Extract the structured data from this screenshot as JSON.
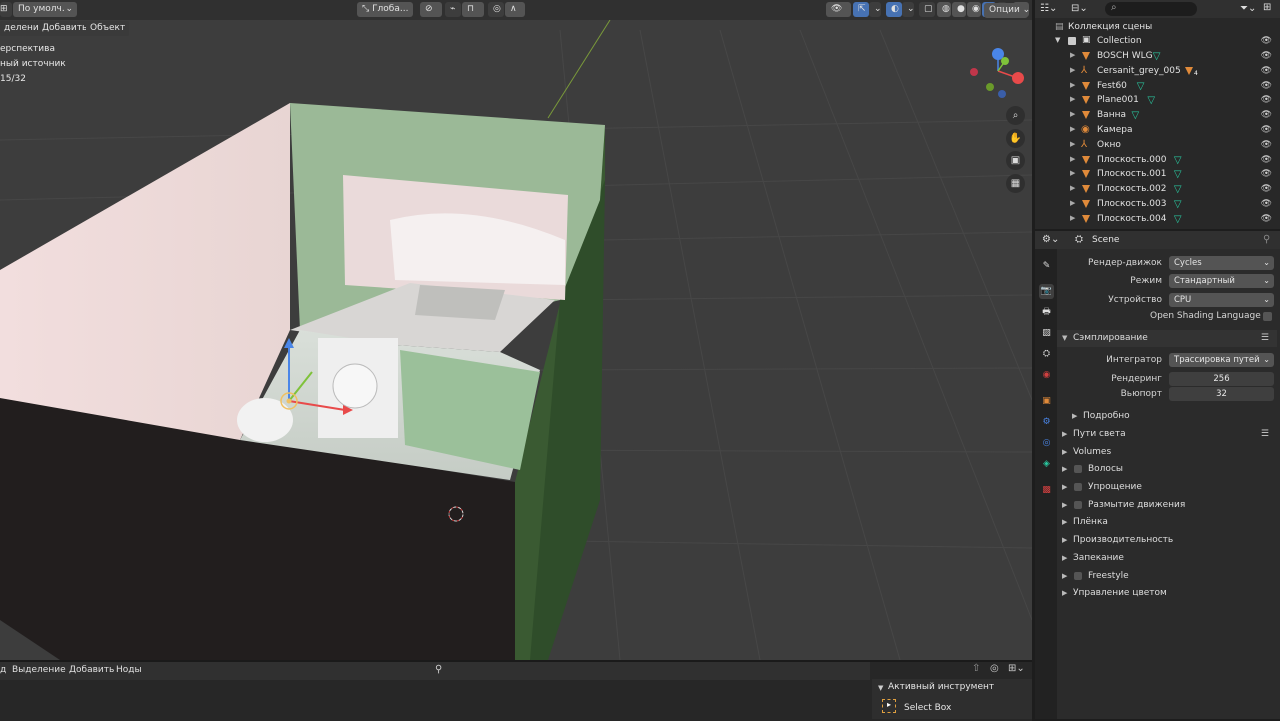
{
  "viewport": {
    "header": {
      "mode_label": "По умолч.",
      "orientation_label": "Глоба...",
      "options_label": "Опции"
    },
    "menu": [
      "деление",
      "Добавить",
      "Объект"
    ],
    "overlay": [
      "ерспектива",
      "ный источник",
      "15/32"
    ]
  },
  "outliner": {
    "search_placeholder": "",
    "scene_collection": "Коллекция сцены",
    "collection": "Collection",
    "items": [
      {
        "label": "BOSCH WLG",
        "icon": "mesh-icon"
      },
      {
        "label": "Cersanit_grey_005",
        "icon": "empty-icon",
        "badge": "4"
      },
      {
        "label": "Fest60",
        "icon": "mesh-icon"
      },
      {
        "label": "Plane001",
        "icon": "mesh-icon"
      },
      {
        "label": "Ванна",
        "icon": "mesh-icon"
      },
      {
        "label": "Камера",
        "icon": "camera-icon"
      },
      {
        "label": "Окно",
        "icon": "empty-icon"
      },
      {
        "label": "Плоскость.000",
        "icon": "mesh-icon"
      },
      {
        "label": "Плоскость.001",
        "icon": "mesh-icon"
      },
      {
        "label": "Плоскость.002",
        "icon": "mesh-icon"
      },
      {
        "label": "Плоскость.003",
        "icon": "mesh-icon"
      },
      {
        "label": "Плоскость.004",
        "icon": "mesh-icon"
      }
    ]
  },
  "properties": {
    "context": "Scene",
    "render_engine": {
      "label": "Рендер-движок",
      "value": "Cycles"
    },
    "mode": {
      "label": "Режим",
      "value": "Стандартный"
    },
    "device": {
      "label": "Устройство",
      "value": "CPU"
    },
    "osl_label": "Open Shading Language",
    "sampling": {
      "title": "Сэмплирование",
      "integrator": {
        "label": "Интегратор",
        "value": "Трассировка путей"
      },
      "render": {
        "label": "Рендеринг",
        "value": "256"
      },
      "viewport": {
        "label": "Вьюпорт",
        "value": "32"
      },
      "details": "Подробно"
    },
    "sections": [
      {
        "label": "Пути света",
        "checkbox": false
      },
      {
        "label": "Volumes",
        "checkbox": false
      },
      {
        "label": "Волосы",
        "checkbox": true
      },
      {
        "label": "Упрощение",
        "checkbox": true
      },
      {
        "label": "Размытие движения",
        "checkbox": true
      },
      {
        "label": "Плёнка",
        "checkbox": false
      },
      {
        "label": "Производительность",
        "checkbox": false
      },
      {
        "label": "Запекание",
        "checkbox": false
      },
      {
        "label": "Freestyle",
        "checkbox": true
      },
      {
        "label": "Управление цветом",
        "checkbox": false
      }
    ]
  },
  "node_editor": {
    "menu": [
      "д",
      "Выделение",
      "Добавить",
      "Ноды"
    ],
    "active_tool_title": "Активный инструмент",
    "tool": "Select Box"
  },
  "colors": {
    "accent": "#4772b3",
    "mesh_filter": "#29c9a0",
    "object": "#e08a3a",
    "wall_green": "#8fae8a"
  }
}
